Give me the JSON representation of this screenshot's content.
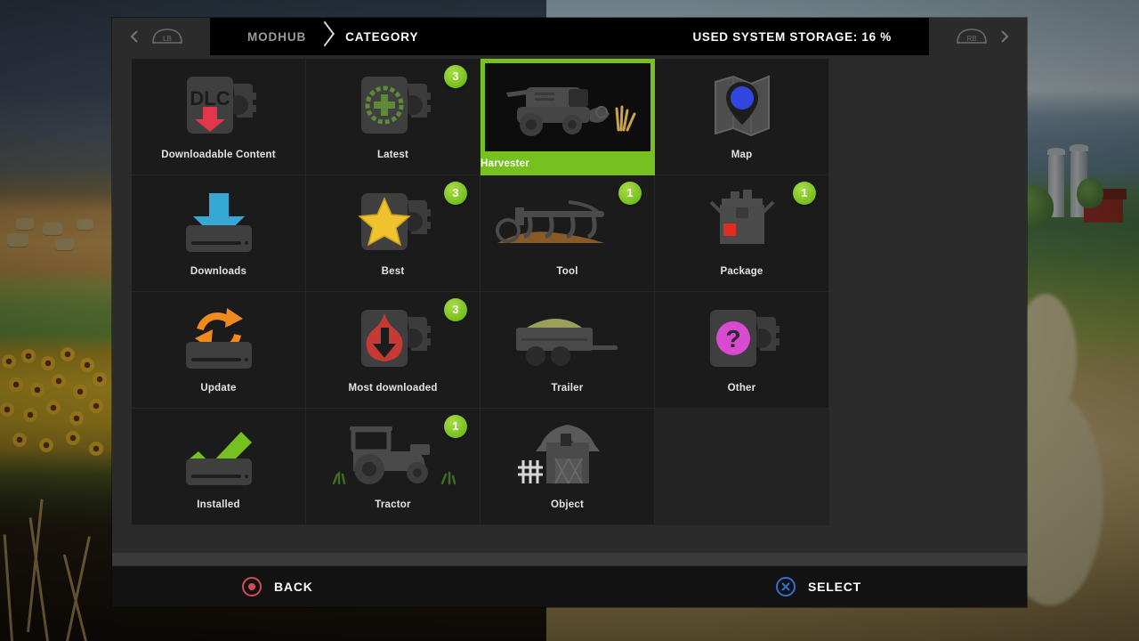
{
  "header": {
    "breadcrumb_1": "MODHUB",
    "breadcrumb_2": "CATEGORY",
    "storage_label": "USED SYSTEM STORAGE: 16 %",
    "prev_icon": "chevron-left-icon",
    "next_icon": "chevron-right-icon",
    "left_bumper_icon": "gamepad-left-bumper-icon",
    "right_bumper_icon": "gamepad-right-bumper-icon"
  },
  "colors": {
    "accent_green": "#76c020",
    "badge_green": "#8fd032",
    "panel_bg": "#2b2b2b",
    "tile_bg": "#1b1b1b",
    "selected_bg": "#000000"
  },
  "grid": {
    "columns": 4,
    "tiles": [
      {
        "label": "Downloadable Content",
        "icon": "dlc-download-icon",
        "badge": null,
        "selected": false
      },
      {
        "label": "Latest",
        "icon": "latest-plus-icon",
        "badge": "3",
        "selected": false
      },
      {
        "label": "Harvester",
        "icon": "harvester-icon",
        "badge": null,
        "selected": true
      },
      {
        "label": "Map",
        "icon": "map-pin-icon",
        "badge": null,
        "selected": false
      },
      {
        "label": "Downloads",
        "icon": "download-arrow-icon",
        "badge": null,
        "selected": false
      },
      {
        "label": "Best",
        "icon": "star-icon",
        "badge": "3",
        "selected": false
      },
      {
        "label": "Tool",
        "icon": "plow-tool-icon",
        "badge": "1",
        "selected": false
      },
      {
        "label": "Package",
        "icon": "package-box-icon",
        "badge": "1",
        "selected": false
      },
      {
        "label": "Update",
        "icon": "update-refresh-icon",
        "badge": null,
        "selected": false
      },
      {
        "label": "Most downloaded",
        "icon": "flame-download-icon",
        "badge": "3",
        "selected": false
      },
      {
        "label": "Trailer",
        "icon": "trailer-icon",
        "badge": null,
        "selected": false
      },
      {
        "label": "Other",
        "icon": "question-mark-icon",
        "badge": null,
        "selected": false
      },
      {
        "label": "Installed",
        "icon": "check-installed-icon",
        "badge": null,
        "selected": false
      },
      {
        "label": "Tractor",
        "icon": "tractor-icon",
        "badge": "1",
        "selected": false
      },
      {
        "label": "Object",
        "icon": "barn-object-icon",
        "badge": null,
        "selected": false
      },
      {
        "label": "",
        "icon": null,
        "badge": null,
        "selected": false,
        "empty": true
      }
    ]
  },
  "footer": {
    "back_label": "BACK",
    "back_icon": "gamepad-circle-button-icon",
    "select_label": "SELECT",
    "select_icon": "gamepad-cross-button-icon"
  }
}
